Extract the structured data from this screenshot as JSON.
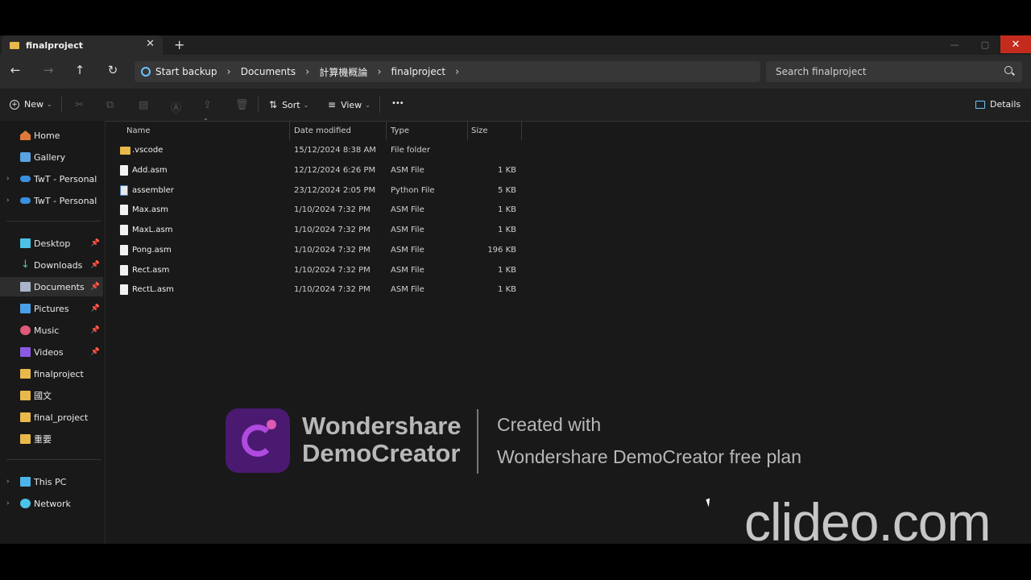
{
  "window": {
    "tab_title": "finalproject",
    "tab_close": "✕",
    "new_tab": "+",
    "controls": {
      "minimize": "—",
      "maximize": "▢",
      "close": "✕"
    }
  },
  "nav": {
    "back": "←",
    "forward": "→",
    "up": "↑",
    "refresh": "↻"
  },
  "address": {
    "backup_label": "Start backup",
    "breadcrumbs": [
      "Documents",
      "計算機概論",
      "finalproject"
    ],
    "separator": "›"
  },
  "search": {
    "placeholder": "Search finalproject"
  },
  "toolbar": {
    "new_label": "New",
    "sort_label": "Sort",
    "view_label": "View",
    "more_label": "•••",
    "details_label": "Details"
  },
  "sidebar": {
    "top": [
      {
        "label": "Home",
        "icon": "home-icon"
      },
      {
        "label": "Gallery",
        "icon": "gallery-icon"
      },
      {
        "label": "TwT - Personal",
        "icon": "cloud-icon"
      },
      {
        "label": "TwT - Personal",
        "icon": "cloud-icon"
      }
    ],
    "quick": [
      {
        "label": "Desktop",
        "icon": "desktop-icon",
        "pinned": true
      },
      {
        "label": "Downloads",
        "icon": "download-icon",
        "pinned": true
      },
      {
        "label": "Documents",
        "icon": "documents-icon",
        "pinned": true,
        "selected": true
      },
      {
        "label": "Pictures",
        "icon": "pictures-icon",
        "pinned": true
      },
      {
        "label": "Music",
        "icon": "music-icon",
        "pinned": true
      },
      {
        "label": "Videos",
        "icon": "videos-icon",
        "pinned": true
      },
      {
        "label": "finalproject",
        "icon": "folder-icon"
      },
      {
        "label": "國文",
        "icon": "folder-icon"
      },
      {
        "label": "final_project",
        "icon": "folder-icon"
      },
      {
        "label": "重要",
        "icon": "folder-icon"
      }
    ],
    "bottom": [
      {
        "label": "This PC",
        "icon": "pc-icon"
      },
      {
        "label": "Network",
        "icon": "network-icon"
      }
    ]
  },
  "files": {
    "columns": [
      "Name",
      "Date modified",
      "Type",
      "Size"
    ],
    "rows": [
      {
        "name": ".vscode",
        "date": "15/12/2024 8:38 AM",
        "type": "File folder",
        "size": "",
        "icon": "folder-icon"
      },
      {
        "name": "Add.asm",
        "date": "12/12/2024 6:26 PM",
        "type": "ASM File",
        "size": "1 KB",
        "icon": "file-icon"
      },
      {
        "name": "assembler",
        "date": "23/12/2024 2:05 PM",
        "type": "Python File",
        "size": "5 KB",
        "icon": "python-file-icon"
      },
      {
        "name": "Max.asm",
        "date": "1/10/2024 7:32 PM",
        "type": "ASM File",
        "size": "1 KB",
        "icon": "file-icon"
      },
      {
        "name": "MaxL.asm",
        "date": "1/10/2024 7:32 PM",
        "type": "ASM File",
        "size": "1 KB",
        "icon": "file-icon"
      },
      {
        "name": "Pong.asm",
        "date": "1/10/2024 7:32 PM",
        "type": "ASM File",
        "size": "196 KB",
        "icon": "file-icon"
      },
      {
        "name": "Rect.asm",
        "date": "1/10/2024 7:32 PM",
        "type": "ASM File",
        "size": "1 KB",
        "icon": "file-icon"
      },
      {
        "name": "RectL.asm",
        "date": "1/10/2024 7:32 PM",
        "type": "ASM File",
        "size": "1 KB",
        "icon": "file-icon"
      }
    ]
  },
  "watermark": {
    "brand_line1": "Wondershare",
    "brand_line2": "DemoCreator",
    "created": "Created with",
    "plan": "Wondershare DemoCreator free plan",
    "clideo": "clideo.com"
  },
  "colors": {
    "accent_close": "#c42b1c",
    "folder": "#e8b84a",
    "background": "#191919"
  }
}
